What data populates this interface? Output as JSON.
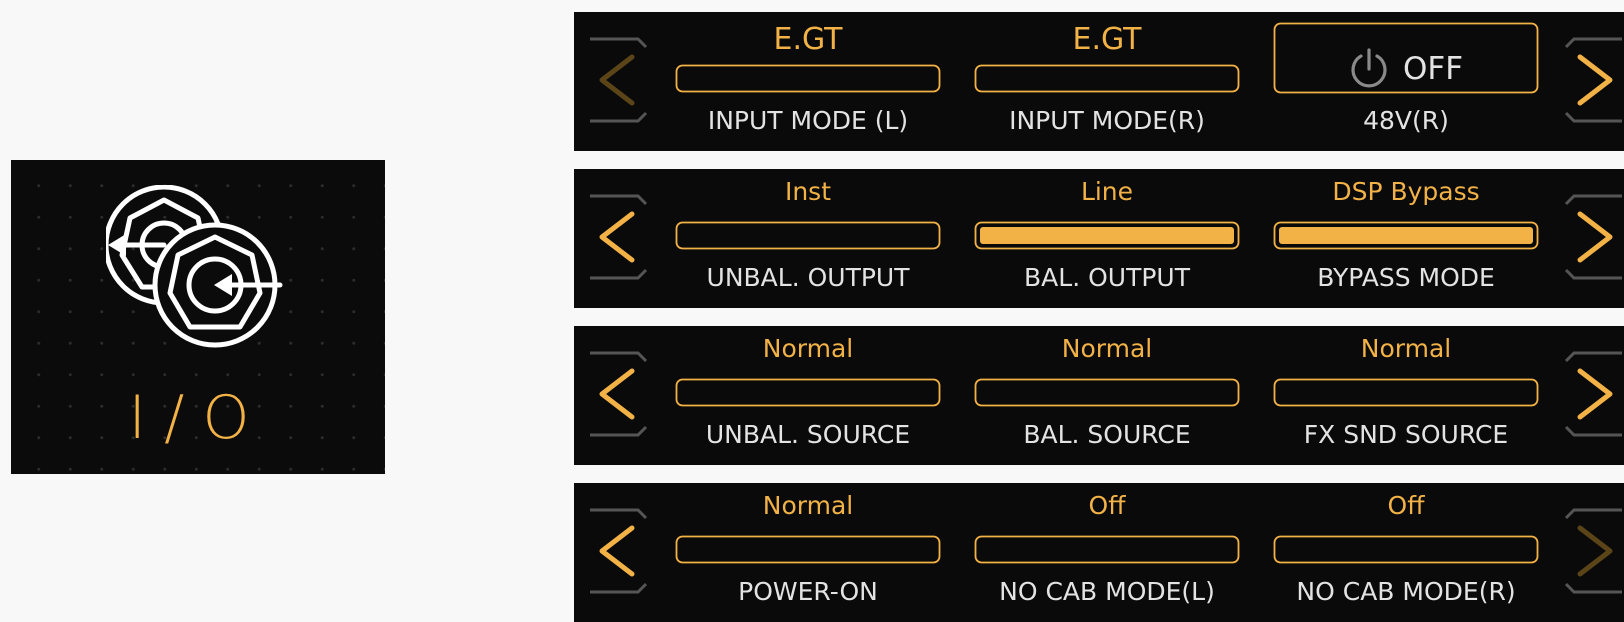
{
  "tile": {
    "label": "I/O",
    "icon": "input-output-jack-icon"
  },
  "colors": {
    "accent": "#f2b246",
    "text": "#e3e3e3",
    "panel": "#0a0a0a",
    "dim_accent": "#5a4418",
    "frame": "#555555"
  },
  "rows": [
    {
      "left_arrow": "dim",
      "right_arrow": "active",
      "cells": [
        {
          "type": "bar",
          "value": "E.GT",
          "label": "INPUT MODE (L)",
          "filled": false
        },
        {
          "type": "bar",
          "value": "E.GT",
          "label": "INPUT MODE(R)",
          "filled": false
        },
        {
          "type": "toggle",
          "value": "OFF",
          "label": "48V(R)",
          "icon": "power-icon"
        }
      ]
    },
    {
      "left_arrow": "active",
      "right_arrow": "active",
      "cells": [
        {
          "type": "bar",
          "value": "Inst",
          "label": "UNBAL. OUTPUT",
          "filled": false
        },
        {
          "type": "bar",
          "value": "Line",
          "label": "BAL. OUTPUT",
          "filled": true
        },
        {
          "type": "bar",
          "value": "DSP Bypass",
          "label": "BYPASS MODE",
          "filled": true
        }
      ]
    },
    {
      "left_arrow": "active",
      "right_arrow": "active",
      "cells": [
        {
          "type": "bar",
          "value": "Normal",
          "label": "UNBAL. SOURCE",
          "filled": false
        },
        {
          "type": "bar",
          "value": "Normal",
          "label": "BAL. SOURCE",
          "filled": false
        },
        {
          "type": "bar",
          "value": "Normal",
          "label": "FX SND SOURCE",
          "filled": false
        }
      ]
    },
    {
      "left_arrow": "active",
      "right_arrow": "dim",
      "cells": [
        {
          "type": "bar",
          "value": "Normal",
          "label": "POWER-ON",
          "filled": false
        },
        {
          "type": "bar",
          "value": "Off",
          "label": "NO CAB MODE(L)",
          "filled": false
        },
        {
          "type": "bar",
          "value": "Off",
          "label": "NO CAB MODE(R)",
          "filled": false
        }
      ]
    }
  ]
}
